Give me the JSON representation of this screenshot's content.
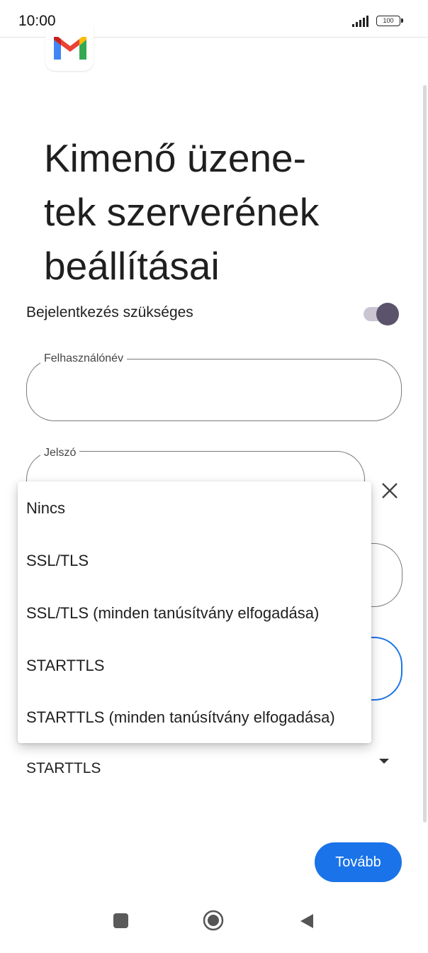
{
  "status_bar": {
    "time": "10:00",
    "battery": "100",
    "signal_icon": "signal-bars-icon",
    "battery_icon": "battery-icon"
  },
  "app": {
    "logo_icon": "gmail-logo-icon"
  },
  "page": {
    "title_lines": [
      "Kimenő üzene-",
      "tek szerverének",
      "beállításai"
    ]
  },
  "form": {
    "login_required_label": "Bejelentkezés szükséges",
    "login_required_on": true,
    "username": {
      "label": "Felhasználónév",
      "value": ""
    },
    "password": {
      "label": "Jelszó",
      "value": ""
    },
    "security_selected": "STARTTLS"
  },
  "security_menu": {
    "options": [
      "Nincs",
      "SSL/TLS",
      "SSL/TLS (minden tanúsítvány elfogadása)",
      "STARTTLS",
      "STARTTLS (minden tanúsítvány elfogadása)"
    ]
  },
  "actions": {
    "next_label": "Tovább"
  },
  "colors": {
    "accent": "#1a73e8",
    "toggle_thumb": "#5a536b",
    "toggle_track": "#c9c5d3"
  }
}
